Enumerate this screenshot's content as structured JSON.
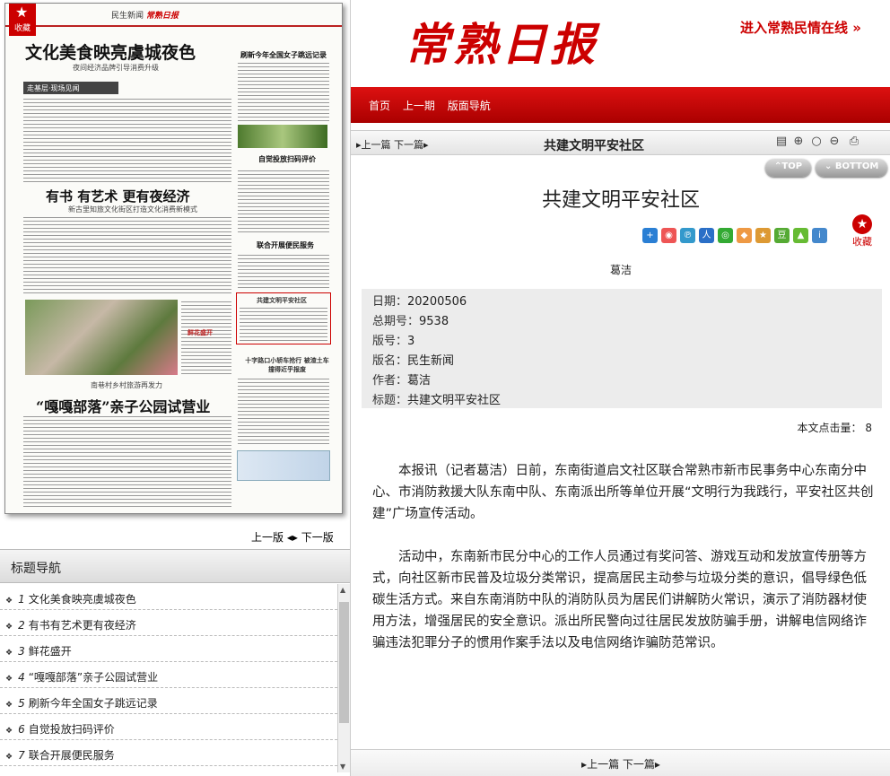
{
  "paper": {
    "fav_label": "收藏",
    "section_meta": "民生新闻",
    "brand": "常熟日报",
    "band_text": "走基层·现场见闻",
    "headlines": [
      "文化美食映亮虞城夜色",
      "有书 有艺术 更有夜经济",
      "“嘎嘎部落”亲子公园试营业",
      "刷新今年全国女子跳远记录",
      "自觉投放扫码评价",
      "联合开展便民服务",
      "共建文明平安社区",
      "十字路口小轿车抢行 被渣土车撞得近乎报废",
      "鲜花盛开"
    ],
    "subheads": [
      "夜间经济品牌引导消费升级",
      "新古里知旅文化街区打造文化消费新模式",
      "南巷村乡村旅游再发力"
    ]
  },
  "pagenav": {
    "prev": "上一版",
    "next": "下一版"
  },
  "topics": {
    "header": "标题导航",
    "items": [
      {
        "num": "1",
        "label": "文化美食映亮虞城夜色"
      },
      {
        "num": "2",
        "label": "有书有艺术更有夜经济"
      },
      {
        "num": "3",
        "label": "鲜花盛开"
      },
      {
        "num": "4",
        "label": "“嘎嘎部落”亲子公园试营业"
      },
      {
        "num": "5",
        "label": "刷新今年全国女子跳远记录"
      },
      {
        "num": "6",
        "label": "自觉投放扫码评价"
      },
      {
        "num": "7",
        "label": "联合开展便民服务"
      }
    ]
  },
  "masthead": {
    "logo": "常熟日报",
    "banner": "进入常熟民情在线",
    "banner_arrow": "»"
  },
  "nav": {
    "home": "首页",
    "prev_issue": "上一期",
    "layout_nav": "版面导航"
  },
  "toolbar": {
    "prev": "上一篇",
    "next": "下一篇",
    "title": "共建文明平安社区"
  },
  "buttons": {
    "top": "TOP",
    "bottom": "BOTTOM"
  },
  "article": {
    "title": "共建文明平安社区",
    "author": "葛洁",
    "fav": "收藏",
    "meta": [
      {
        "key": "日期：",
        "value": "20200506"
      },
      {
        "key": "总期号：",
        "value": "9538"
      },
      {
        "key": "版号：",
        "value": "3"
      },
      {
        "key": "版名：",
        "value": "民生新闻"
      },
      {
        "key": "作者：",
        "value": "葛洁"
      },
      {
        "key": "标题：",
        "value": "共建文明平安社区"
      }
    ],
    "word_count_label": "本文点击量：",
    "word_count": "8",
    "paragraphs": [
      "本报讯（记者葛洁）日前，东南街道启文社区联合常熟市新市民事务中心东南分中心、市消防救援大队东南中队、东南派出所等单位开展“文明行为我践行，平安社区共创建”广场宣传活动。",
      "活动中，东南新市民分中心的工作人员通过有奖问答、游戏互动和发放宣传册等方式，向社区新市民普及垃圾分类常识，提高居民主动参与垃圾分类的意识，倡导绿色低碳生活方式。来自东南消防中队的消防队员为居民们讲解防火常识，演示了消防器材使用方法，增强居民的安全意识。派出所民警向过往居民发放防骗手册，讲解电信网络诈骗违法犯罪分子的惯用作案手法以及电信网络诈骗防范常识。"
    ]
  },
  "bottom_nav": {
    "prev": "上一篇",
    "next": "下一篇"
  },
  "colors": {
    "brand_red": "#cc0000",
    "nav_bar": "#c00000"
  }
}
